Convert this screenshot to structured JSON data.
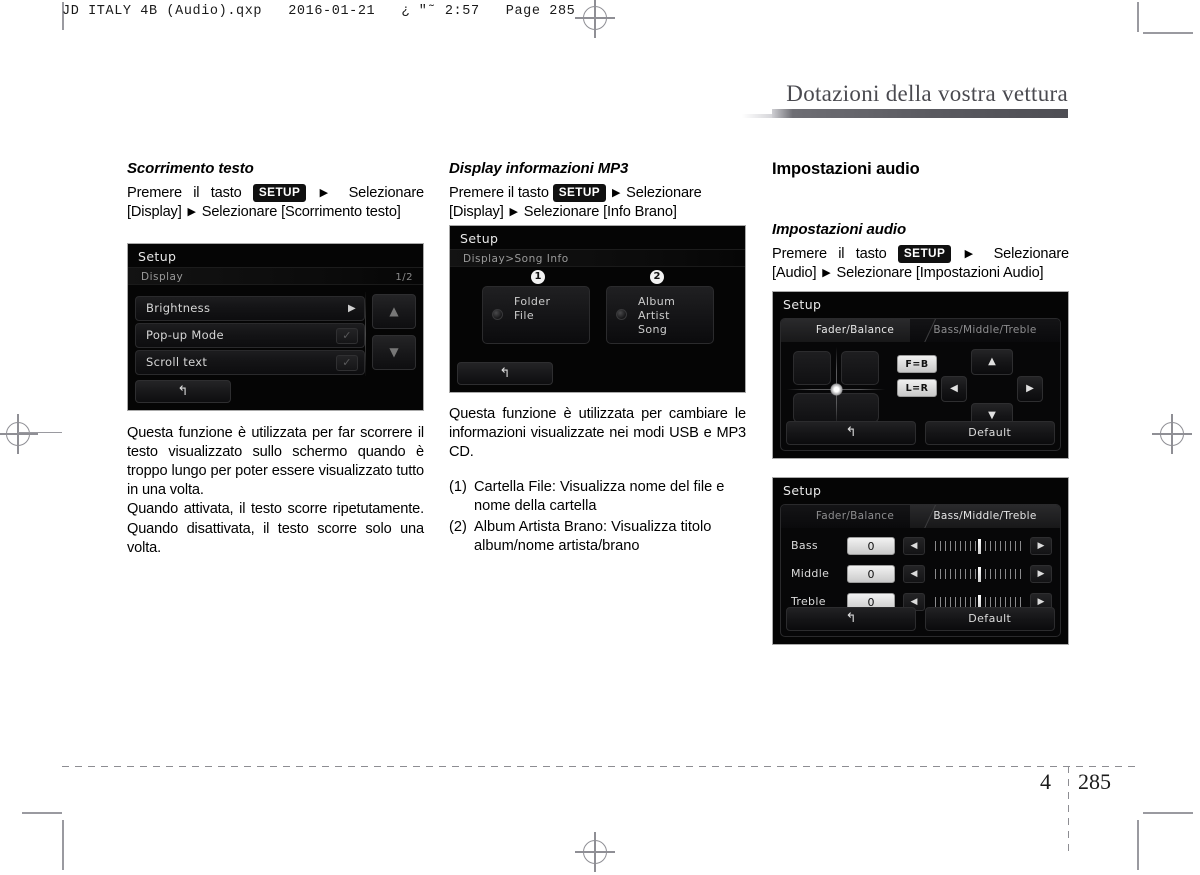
{
  "print_header": "JD ITALY 4B (Audio).qxp   2016-01-21   ¿ \"˜ 2:57   Page 285",
  "chapter_title": "Dotazioni della vostra vettura",
  "footer": {
    "chapter": "4",
    "page": "285"
  },
  "columns": {
    "left": {
      "heading": "Scorrimento testo",
      "instruction_pre": "Premere il tasto",
      "setup_label": "SETUP",
      "instruction_post": "Selezionare [Display]",
      "instruction_post2": "Selezionare [Scorrimento testo]",
      "paragraph1": "Questa funzione è utilizzata per far scorrere il testo visualizzato sullo schermo quando è troppo lungo per poter essere visualizzato tutto in una volta.",
      "paragraph2": "Quando attivata, il testo scorre ripetutamente. Quando disattivata, il testo scorre solo una volta."
    },
    "middle": {
      "heading": "Display informazioni MP3",
      "instruction_pre": "Premere il tasto",
      "setup_label": "SETUP",
      "instruction_post": "Selezionare [Display]",
      "instruction_post2": "Selezionare [Info Brano]",
      "paragraph1": "Questa funzione è utilizzata per cambiare le informazioni visualizzate nei modi USB e MP3 CD.",
      "list": [
        {
          "label": "(1)",
          "text": "Cartella File: Visualizza nome del file e nome della cartella"
        },
        {
          "label": "(2)",
          "text": "Album Artista Brano: Visualizza titolo album/nome artista/brano"
        }
      ]
    },
    "right": {
      "main_heading": "Impostazioni audio",
      "sub_heading": "Impostazioni audio",
      "instruction_pre": "Premere il tasto",
      "setup_label": "SETUP",
      "instruction_post": "Selezionare [Audio]",
      "instruction_post2": "Selezionare [Impostazioni Audio]"
    }
  },
  "screens": {
    "display_setup": {
      "title": "Setup",
      "breadcrumb": "Display",
      "page_indicator": "1/2",
      "rows": [
        {
          "label": "Brightness",
          "control": "arrow",
          "glyph": "▶"
        },
        {
          "label": "Pop-up Mode",
          "control": "check",
          "glyph": "✓"
        },
        {
          "label": "Scroll text",
          "control": "check",
          "glyph": "✓"
        }
      ],
      "scroll_up": "▲",
      "scroll_down": "▼",
      "back": "↰"
    },
    "song_info": {
      "title": "Setup",
      "breadcrumb": "Display>Song Info",
      "options": [
        {
          "badge": "❶",
          "badge_num": "1",
          "lines": [
            "Folder",
            "File"
          ]
        },
        {
          "badge": "❷",
          "badge_num": "2",
          "lines": [
            "Album",
            "Artist",
            "Song"
          ]
        }
      ],
      "back": "↰"
    },
    "fader_balance": {
      "title": "Setup",
      "tab_left": "Fader/Balance",
      "tab_right": "Bass/Middle/Treble",
      "fb_button": "F=B",
      "lr_button": "L=R",
      "dpad": {
        "up": "▲",
        "down": "▼",
        "left": "◀",
        "right": "▶"
      },
      "back": "↰",
      "default": "Default"
    },
    "equalizer": {
      "title": "Setup",
      "tab_left": "Fader/Balance",
      "tab_right": "Bass/Middle/Treble",
      "rows": [
        {
          "label": "Bass",
          "value": "0",
          "dec": "◀",
          "inc": "▶"
        },
        {
          "label": "Middle",
          "value": "0",
          "dec": "◀",
          "inc": "▶"
        },
        {
          "label": "Treble",
          "value": "0",
          "dec": "◀",
          "inc": "▶"
        }
      ],
      "back": "↰",
      "default": "Default"
    }
  }
}
